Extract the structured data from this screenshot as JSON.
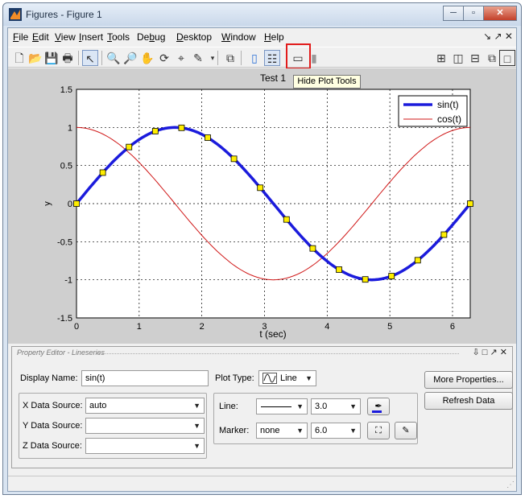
{
  "window": {
    "title": "Figures - Figure 1",
    "buttons": [
      "─",
      "▫",
      "✕"
    ]
  },
  "menubar": {
    "items": [
      {
        "u": "F",
        "rest": "ile"
      },
      {
        "u": "E",
        "rest": "dit"
      },
      {
        "u": "V",
        "rest": "iew"
      },
      {
        "u": "I",
        "rest": "nsert"
      },
      {
        "u": "T",
        "rest": "ools"
      },
      {
        "pre": "De",
        "u": "b",
        "rest": "ug"
      },
      {
        "u": "D",
        "rest": "esktop"
      },
      {
        "u": "W",
        "rest": "indow"
      },
      {
        "u": "H",
        "rest": "elp"
      }
    ],
    "right": "↘ ↗ ✕"
  },
  "toolbar": {
    "tooltip": "Hide Plot Tools"
  },
  "chart_data": {
    "type": "line",
    "title": "Test 1",
    "xlabel": "t (sec)",
    "ylabel": "y",
    "xlim": [
      0,
      6.283
    ],
    "ylim": [
      -1.5,
      1.5
    ],
    "xticks": [
      0,
      1,
      2,
      3,
      4,
      5,
      6
    ],
    "yticks": [
      -1.5,
      -1,
      -0.5,
      0,
      0.5,
      1,
      1.5
    ],
    "ytick_labels": [
      "-1.5",
      "-1",
      "-0.5",
      "0",
      "0.5",
      "1",
      "1.5"
    ],
    "grid": true,
    "legend_position": "top-right",
    "series": [
      {
        "name": "sin(t)",
        "color": "#1b1bdc",
        "marker": "square",
        "marker_face": "#ffee00",
        "x": [
          0,
          0.419,
          0.838,
          1.257,
          1.676,
          2.094,
          2.513,
          2.932,
          3.351,
          3.77,
          4.189,
          4.608,
          5.027,
          5.445,
          5.864,
          6.283
        ],
        "y": [
          0,
          0.407,
          0.743,
          0.951,
          0.995,
          0.866,
          0.588,
          0.208,
          -0.208,
          -0.588,
          -0.866,
          -0.995,
          -0.951,
          -0.743,
          -0.407,
          0
        ]
      },
      {
        "name": "cos(t)",
        "color": "#d01818",
        "x": [
          0,
          0.419,
          0.838,
          1.257,
          1.676,
          2.094,
          2.513,
          2.932,
          3.351,
          3.77,
          4.189,
          4.608,
          5.027,
          5.445,
          5.864,
          6.283
        ],
        "y": [
          1,
          0.914,
          0.669,
          0.309,
          -0.105,
          -0.5,
          -0.809,
          -0.978,
          -0.978,
          -0.809,
          -0.5,
          -0.105,
          0.309,
          0.669,
          0.914,
          1
        ]
      }
    ]
  },
  "property_editor": {
    "title": "Property Editor - Lineseries",
    "controls": "⇩ □ ↗ ✕",
    "display_name_label": "Display Name:",
    "display_name_value": "sin(t)",
    "plot_type_label": "Plot Type:",
    "plot_type_value": "Line",
    "x_source_label": "X Data Source:",
    "x_source_value": "auto",
    "y_source_label": "Y Data Source:",
    "y_source_value": "",
    "z_source_label": "Z Data Source:",
    "z_source_value": "",
    "line_label": "Line:",
    "line_width": "3.0",
    "marker_label": "Marker:",
    "marker_value": "none",
    "marker_size": "6.0",
    "more_properties": "More Properties...",
    "refresh_data": "Refresh Data"
  }
}
